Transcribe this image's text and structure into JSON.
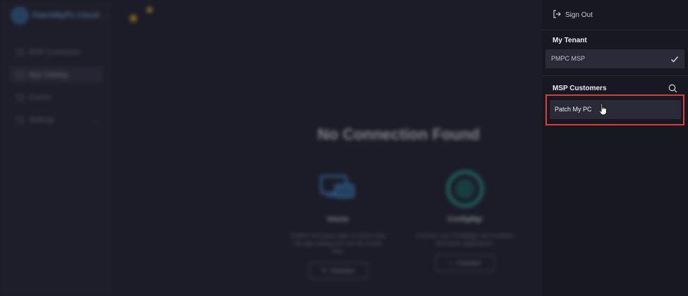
{
  "app": {
    "logo_text": "PatchMyPC Cloud"
  },
  "sidebar": {
    "items": [
      {
        "label": "MSP Customers",
        "icon": "users-icon"
      },
      {
        "label": "App Catalog",
        "icon": "grid-icon"
      },
      {
        "label": "Events",
        "icon": "clock-icon"
      },
      {
        "label": "Settings",
        "icon": "gear-icon"
      }
    ]
  },
  "main": {
    "empty_title": "No Connection Found",
    "cards": [
      {
        "name": "Intune",
        "description": "Publish third-party apps to Intune from the app catalog and use the wizard flow.",
        "button": "Connect"
      },
      {
        "name": "ConfigMgr",
        "description": "Connect your ConfigMgr site to publish third-party applications.",
        "button": "Connect"
      }
    ]
  },
  "panel": {
    "sign_out": "Sign Out",
    "my_tenant_title": "My Tenant",
    "tenant_name": "PMPC MSP",
    "msp_customers_title": "MSP Customers",
    "customer_name": "Patch My PC"
  },
  "colors": {
    "highlight": "#d83c3c",
    "accent": "#3f7fbf"
  }
}
